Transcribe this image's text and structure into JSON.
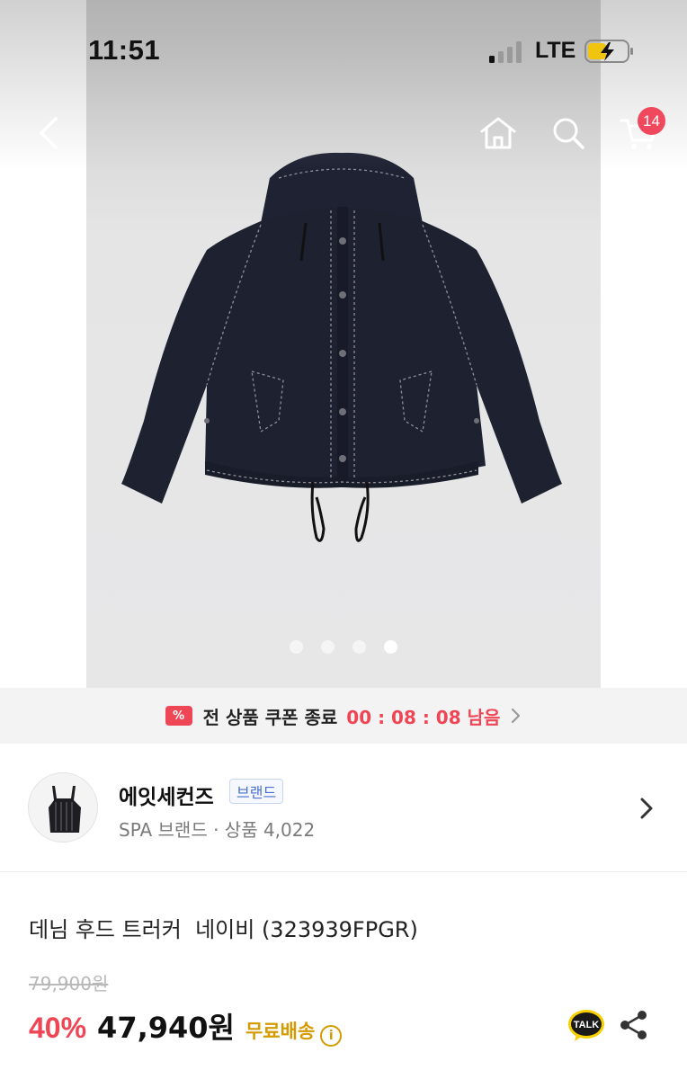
{
  "status_bar": {
    "time": "11:51",
    "network": "LTE"
  },
  "nav": {
    "back_icon": "chevron-left-icon",
    "home_icon": "home-icon",
    "search_icon": "search-icon",
    "cart_icon": "cart-icon",
    "cart_count": "14",
    "badge_color": "#f0485c"
  },
  "hero": {
    "image_subject": "jacket",
    "carousel": {
      "total": 4,
      "active": 4
    }
  },
  "coupon_banner": {
    "icon_glyph": "%",
    "text": "전 상품 쿠폰 종료",
    "timer": "00 : 08 : 08 남음",
    "accent_color": "#ef4656"
  },
  "brand": {
    "name": "에잇세컨즈",
    "tag": "브랜드",
    "meta": "SPA 브랜드 · 상품 4,022"
  },
  "product": {
    "title": "데님 후드 트러커  네이비 (323939FPGR)",
    "original_price": "79,900원",
    "discount": "40%",
    "price": "47,940원",
    "shipping": "무료배송",
    "info_glyph": "i",
    "talk_label": "TALK"
  }
}
